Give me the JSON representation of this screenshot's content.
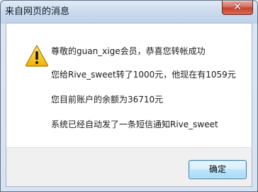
{
  "dialog": {
    "title": "来自网页的消息",
    "close_label": "✕",
    "icon": "warning-icon",
    "messages": [
      "尊敬的guan_xige会员，恭喜您转帐成功",
      "您给Rive_sweet转了1000元，他现在有1059元",
      "您目前账户的余额为36710元",
      "系统已经自动发了一条短信通知Rive_sweet"
    ],
    "ok_label": "确定"
  },
  "colors": {
    "warning_fill": "#f5c400",
    "warning_border": "#b57f00",
    "button_border": "#3c7fb1",
    "close_red": "#c7432f"
  }
}
